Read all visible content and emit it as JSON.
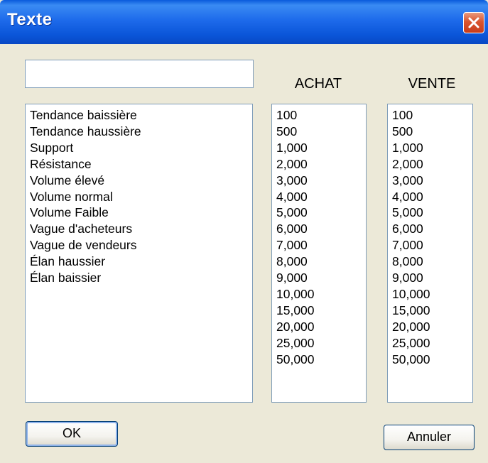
{
  "window": {
    "title": "Texte"
  },
  "text_input": {
    "value": ""
  },
  "columns": {
    "achat_header": "ACHAT",
    "vente_header": "VENTE"
  },
  "list_labels": [
    "Tendance baissière",
    "Tendance haussière",
    "Support",
    "Résistance",
    "Volume élevé",
    "Volume normal",
    "Volume Faible",
    "Vague d'acheteurs",
    "Vague de vendeurs",
    "Élan haussier",
    "Élan baissier"
  ],
  "list_achat": [
    "100",
    "500",
    "1,000",
    "2,000",
    "3,000",
    "4,000",
    "5,000",
    "6,000",
    "7,000",
    "8,000",
    "9,000",
    "10,000",
    "15,000",
    "20,000",
    "25,000",
    "50,000"
  ],
  "list_vente": [
    "100",
    "500",
    "1,000",
    "2,000",
    "3,000",
    "4,000",
    "5,000",
    "6,000",
    "7,000",
    "8,000",
    "9,000",
    "10,000",
    "15,000",
    "20,000",
    "25,000",
    "50,000"
  ],
  "buttons": {
    "ok_label": "OK",
    "cancel_label": "Annuler"
  },
  "icons": {
    "close": "close-icon"
  },
  "colors": {
    "titlebar": "#0A55D8",
    "window_bg": "#ECE9D8",
    "close_button": "#D9542E"
  }
}
